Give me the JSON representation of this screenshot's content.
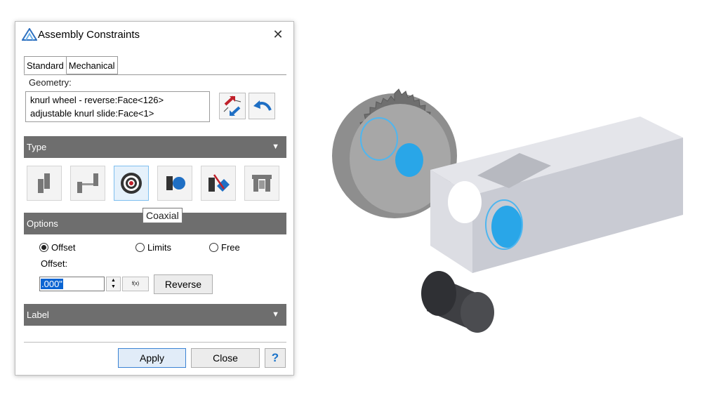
{
  "dialog": {
    "title": "Assembly Constraints",
    "close_glyph": "✕",
    "tabs": [
      {
        "label": "Standard",
        "active": true
      },
      {
        "label": "Mechanical",
        "active": false
      }
    ],
    "geometry": {
      "label": "Geometry:",
      "items": [
        "knurl wheel - reverse:Face<126>",
        "adjustable knurl slide:Face<1>"
      ],
      "buttons": [
        {
          "name": "swap-selection-icon"
        },
        {
          "name": "undo-arrow-icon"
        }
      ]
    },
    "type_section": {
      "label": "Type",
      "caret": "▼",
      "buttons": [
        {
          "name": "mate-icon",
          "active": false
        },
        {
          "name": "distance-icon",
          "active": false
        },
        {
          "name": "coaxial-icon",
          "active": true
        },
        {
          "name": "tangent-icon",
          "active": false
        },
        {
          "name": "angle-icon",
          "active": false
        },
        {
          "name": "fixed-icon",
          "active": false
        }
      ],
      "tooltip": "Coaxial"
    },
    "options_section": {
      "label": "Options",
      "radios": [
        {
          "label": "Offset",
          "selected": true
        },
        {
          "label": "Limits",
          "selected": false
        },
        {
          "label": "Free",
          "selected": false
        }
      ],
      "offset_label": "Offset:",
      "offset_value": ".000\"",
      "spin_up": "▲",
      "spin_down": "▼",
      "fx_label": "f(x)",
      "reverse_label": "Reverse"
    },
    "label_section": {
      "label": "Label",
      "caret": "▼"
    },
    "footer": {
      "apply_label": "Apply",
      "close_label": "Close",
      "help_label": "?"
    }
  },
  "colors": {
    "section_bar": "#6e6e6e",
    "selection_highlight": "#0a64d2",
    "face_highlight": "#4fb6ef",
    "accent_red": "#c0202a",
    "accent_blue": "#1f6fc4"
  }
}
